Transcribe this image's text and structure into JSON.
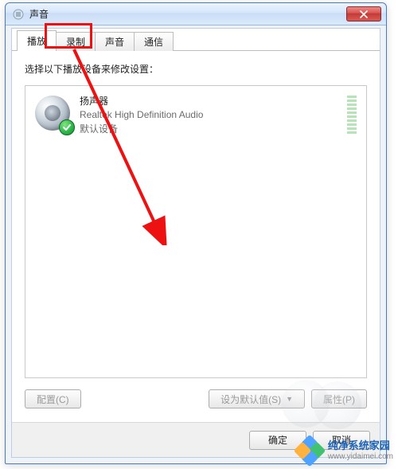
{
  "window": {
    "title": "声音",
    "close_icon": "close-icon"
  },
  "tabs": [
    {
      "label": "播放"
    },
    {
      "label": "录制"
    },
    {
      "label": "声音"
    },
    {
      "label": "通信"
    }
  ],
  "active_tab_index": 0,
  "instruction": "选择以下播放设备来修改设置：",
  "devices": [
    {
      "name": "扬声器",
      "driver": "Realtek High Definition Audio",
      "status": "默认设备",
      "default": true
    }
  ],
  "buttons": {
    "configure": "配置(C)",
    "set_default": "设为默认值(S)",
    "properties": "属性(P)",
    "ok": "确定",
    "cancel": "取消"
  },
  "watermark": {
    "line1": "纯净系统家园",
    "line2": "www.yidaimei.com"
  }
}
